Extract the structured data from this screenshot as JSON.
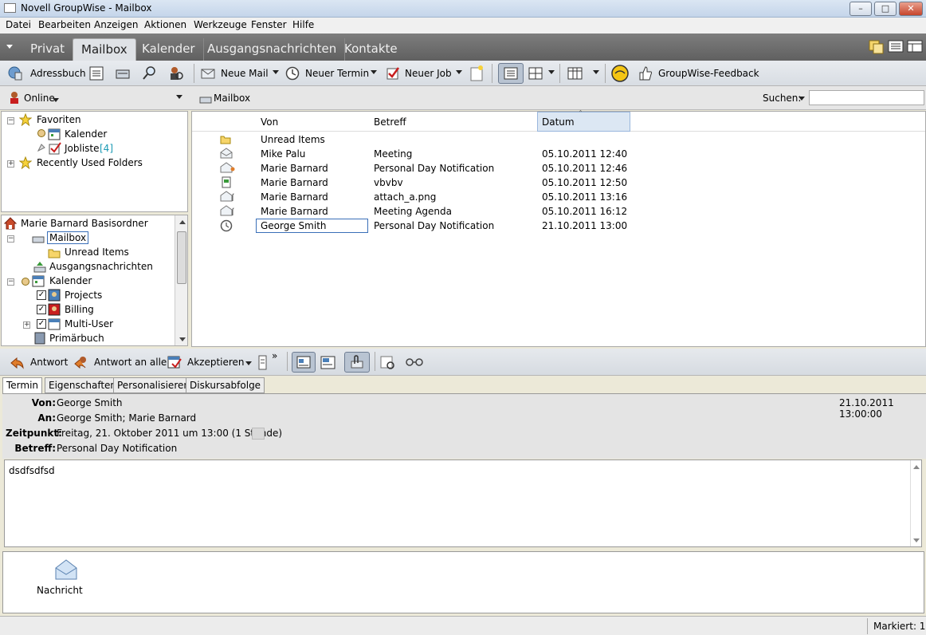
{
  "window": {
    "title": "Novell GroupWise - Mailbox",
    "min": "–",
    "max": "□",
    "close": "✕"
  },
  "menu": [
    "Datei",
    "Bearbeiten",
    "Anzeigen",
    "Aktionen",
    "Werkzeuge",
    "Fenster",
    "Hilfe"
  ],
  "tabs": [
    "Privat",
    "Mailbox",
    "Kalender",
    "Ausgangsnachrichten",
    "Kontakte"
  ],
  "toolbar": {
    "adressbuch": "Adressbuch",
    "neue_mail": "Neue Mail",
    "neuer_termin": "Neuer Termin",
    "neuer_job": "Neuer Job",
    "feedback": "GroupWise-Feedback"
  },
  "folderbar": {
    "online": "Online",
    "mailbox": "Mailbox",
    "search_label": "Suchen:",
    "search_value": ""
  },
  "favorites": {
    "root": "Favoriten",
    "kalender": "Kalender",
    "jobliste": "Jobliste",
    "jobliste_count": "[4]",
    "recent": "Recently Used Folders"
  },
  "folders": {
    "root": "Marie Barnard Basisordner",
    "mailbox": "Mailbox",
    "unread": "Unread Items",
    "ausgang": "Ausgangsnachrichten",
    "kalender": "Kalender",
    "projects": "Projects",
    "billing": "Billing",
    "multiuser": "Multi-User",
    "primaer": "Primärbuch"
  },
  "list": {
    "columns": {
      "von": "Von",
      "betreff": "Betreff",
      "datum": "Datum"
    },
    "folder_row": "Unread Items",
    "rows": [
      {
        "von": "Mike Palu",
        "betreff": "Meeting",
        "datum": "05.10.2011 12:40",
        "icon": "envelope-open-icon"
      },
      {
        "von": "Marie Barnard",
        "betreff": "Personal Day Notification",
        "datum": "05.10.2011 12:46",
        "icon": "envelope-flag-icon"
      },
      {
        "von": "Marie Barnard",
        "betreff": "vbvbv",
        "datum": "05.10.2011 12:50",
        "icon": "document-icon"
      },
      {
        "von": "Marie Barnard",
        "betreff": "attach_a.png",
        "datum": "05.10.2011 13:16",
        "icon": "envelope-attach-icon"
      },
      {
        "von": "Marie Barnard",
        "betreff": "Meeting Agenda",
        "datum": "05.10.2011 16:12",
        "icon": "envelope-attach-icon"
      },
      {
        "von": "George Smith",
        "betreff": "Personal Day Notification",
        "datum": "21.10.2011 13:00",
        "icon": "clock-icon"
      }
    ]
  },
  "actionbar": {
    "antwort": "Antwort",
    "antwort_alle": "Antwort an alle",
    "akzeptieren": "Akzeptieren",
    "more": "»"
  },
  "preview_tabs": [
    "Termin",
    "Eigenschaften",
    "Personalisieren",
    "Diskursabfolge"
  ],
  "preview": {
    "von_label": "Von:",
    "von": "George Smith",
    "an_label": "An:",
    "an": "George Smith; Marie Barnard",
    "zeit_label": "Zeitpunkt:",
    "zeit": "Freitag, 21. Oktober 2011 um 13:00 (1 Stunde)",
    "betreff_label": "Betreff:",
    "betreff": "Personal Day Notification",
    "datum": "21.10.2011 13:00:00",
    "body": "dsdfsdfsd"
  },
  "attachment": {
    "label": "Nachricht"
  },
  "status": {
    "markiert": "Markiert: 1"
  }
}
